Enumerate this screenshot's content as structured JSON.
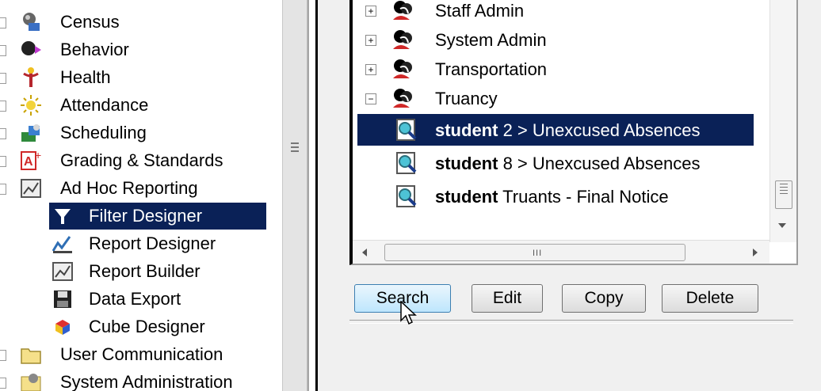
{
  "nav": {
    "items": [
      {
        "label": "Census",
        "icon": "census-icon",
        "level": "top"
      },
      {
        "label": "Behavior",
        "icon": "behavior-icon",
        "level": "top"
      },
      {
        "label": "Health",
        "icon": "health-caduceus-icon",
        "level": "top"
      },
      {
        "label": "Attendance",
        "icon": "attendance-sun-icon",
        "level": "top"
      },
      {
        "label": "Scheduling",
        "icon": "scheduling-icon",
        "level": "top"
      },
      {
        "label": "Grading & Standards",
        "icon": "grading-a-plus-icon",
        "level": "top"
      },
      {
        "label": "Ad Hoc Reporting",
        "icon": "ad-hoc-report-icon",
        "level": "top"
      },
      {
        "label": "Filter Designer",
        "icon": "filter-funnel-icon",
        "level": "child",
        "selected": true
      },
      {
        "label": "Report Designer",
        "icon": "report-designer-icon",
        "level": "child"
      },
      {
        "label": "Report Builder",
        "icon": "report-builder-icon",
        "level": "child"
      },
      {
        "label": "Data Export",
        "icon": "floppy-disk-icon",
        "level": "child"
      },
      {
        "label": "Cube Designer",
        "icon": "cube-icon",
        "level": "child"
      },
      {
        "label": "User Communication",
        "icon": "folder-icon",
        "level": "top"
      },
      {
        "label": "System Administration",
        "icon": "system-admin-icon",
        "level": "top"
      }
    ]
  },
  "tree": {
    "groups": [
      {
        "label": "Staff Admin",
        "expander": "+"
      },
      {
        "label": "System Admin",
        "expander": "+"
      },
      {
        "label": "Transportation",
        "expander": "+"
      },
      {
        "label": "Truancy",
        "expander": "−"
      }
    ],
    "filters": [
      {
        "bold": "student",
        "rest": " 2 > Unexcused Absences",
        "selected": true
      },
      {
        "bold": "student",
        "rest": " 8 > Unexcused Absences",
        "selected": false
      },
      {
        "bold": "student",
        "rest": " Truants - Final Notice",
        "selected": false
      }
    ],
    "hscroll_grip": "III"
  },
  "buttons": {
    "search": "Search",
    "edit": "Edit",
    "copy": "Copy",
    "delete": "Delete"
  },
  "colors": {
    "selection": "#0a2157",
    "button_focus": "#bee6fd"
  }
}
